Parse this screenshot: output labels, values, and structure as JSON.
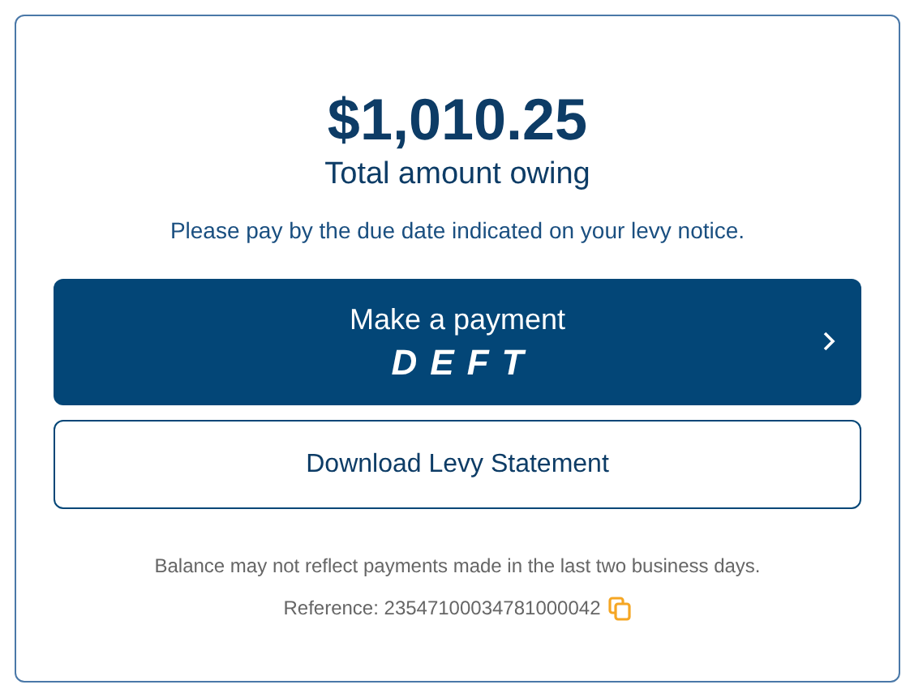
{
  "amount": "$1,010.25",
  "amount_label": "Total amount owing",
  "instruction": "Please pay by the due date indicated on your levy notice.",
  "pay_button": {
    "label": "Make a payment",
    "logo": "DEFT"
  },
  "statement_button": {
    "label": "Download Levy Statement"
  },
  "note": "Balance may not reflect payments made in the last two business days.",
  "reference": "Reference: 23547100034781000042"
}
